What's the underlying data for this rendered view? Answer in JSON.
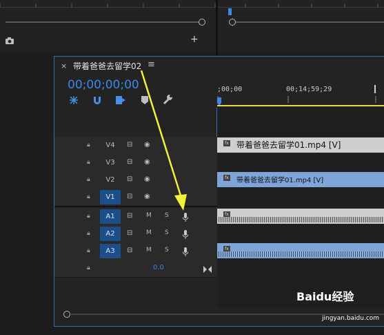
{
  "sequence_tab": {
    "close": "×",
    "title": "带着爸爸去留学02",
    "menu": "≡"
  },
  "timecode": "00;00;00;00",
  "ruler": {
    "labels": [
      ";00;00",
      "00;14;59;29"
    ]
  },
  "tracks": {
    "video": [
      {
        "name": "V4",
        "selected": false
      },
      {
        "name": "V3",
        "selected": false
      },
      {
        "name": "V2",
        "selected": false
      },
      {
        "name": "V1",
        "selected": true
      }
    ],
    "audio": [
      {
        "name": "A1",
        "mute": "M",
        "solo": "S",
        "selected": true
      },
      {
        "name": "A2",
        "mute": "M",
        "solo": "S",
        "selected": true
      },
      {
        "name": "A3",
        "mute": "M",
        "solo": "S",
        "selected": true
      }
    ],
    "master_value": "0.0"
  },
  "clips": {
    "v4_clip": "带着爸爸去留学01.mp4 [V]",
    "v2_clip": "带着爸爸去留学01.mp4 [V]",
    "fx_label": "fx"
  },
  "watermark": {
    "brand": "Baidu经验",
    "url": "jingyan.baidu.com"
  },
  "colors": {
    "accent_blue": "#3c87e8",
    "selected_track": "#1c4f8a",
    "playhead": "#e8d84a",
    "arrow": "#f2f23a",
    "video_clip_light": "#cfcfcf",
    "video_clip_blue": "#7ea4d8"
  }
}
